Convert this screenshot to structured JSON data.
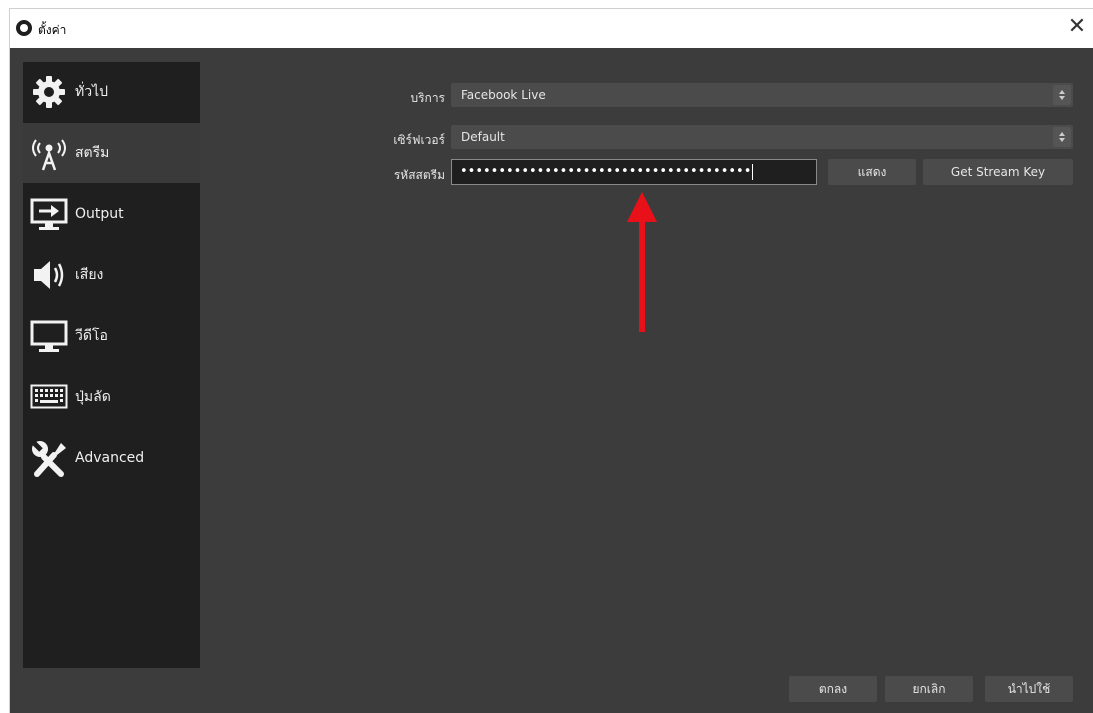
{
  "window": {
    "title": "ตั้งค่า",
    "close_glyph": "✕"
  },
  "sidebar": {
    "items": [
      {
        "label": "ทั่วไป",
        "icon": "gear-icon"
      },
      {
        "label": "สตรีม",
        "icon": "antenna-icon"
      },
      {
        "label": "Output",
        "icon": "output-icon"
      },
      {
        "label": "เสียง",
        "icon": "speaker-icon"
      },
      {
        "label": "วีดีโอ",
        "icon": "monitor-icon"
      },
      {
        "label": "ปุ่มลัด",
        "icon": "keyboard-icon"
      },
      {
        "label": "Advanced",
        "icon": "tools-icon"
      }
    ],
    "active_index": 1
  },
  "stream": {
    "service_label": "บริการ",
    "service_value": "Facebook Live",
    "server_label": "เซิร์ฟเวอร์",
    "server_value": "Default",
    "key_label": "รหัสสตรีม",
    "key_value": "••••••••••••••••••••••••••••••••••••••",
    "show_button": "แสดง",
    "get_key_button": "Get Stream Key"
  },
  "footer": {
    "ok_button": "ตกลง",
    "cancel_button": "ยกเลิก",
    "apply_button": "นำไปใช้"
  },
  "annotation": {
    "arrow_color": "#e8111a"
  }
}
